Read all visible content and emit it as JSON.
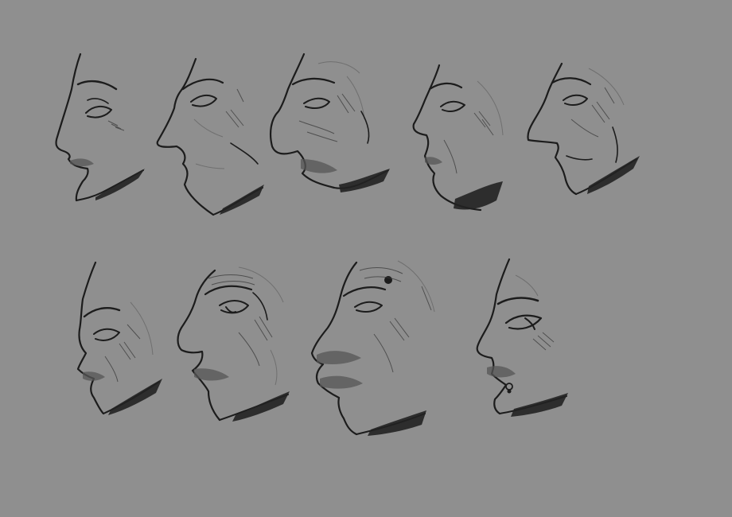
{
  "canvas": {
    "background": "#8f8f8f",
    "ink_color": "#1c1c1c"
  },
  "sketches": [
    {
      "name": "young-woman-profile"
    },
    {
      "name": "pointed-nose-man-profile"
    },
    {
      "name": "old-man-profile"
    },
    {
      "name": "middle-aged-man-profile"
    },
    {
      "name": "long-nose-man-profile"
    },
    {
      "name": "wrinkled-man-profile"
    },
    {
      "name": "big-nose-old-man-profile"
    },
    {
      "name": "large-lip-man-profile"
    },
    {
      "name": "pierced-woman-profile"
    }
  ]
}
